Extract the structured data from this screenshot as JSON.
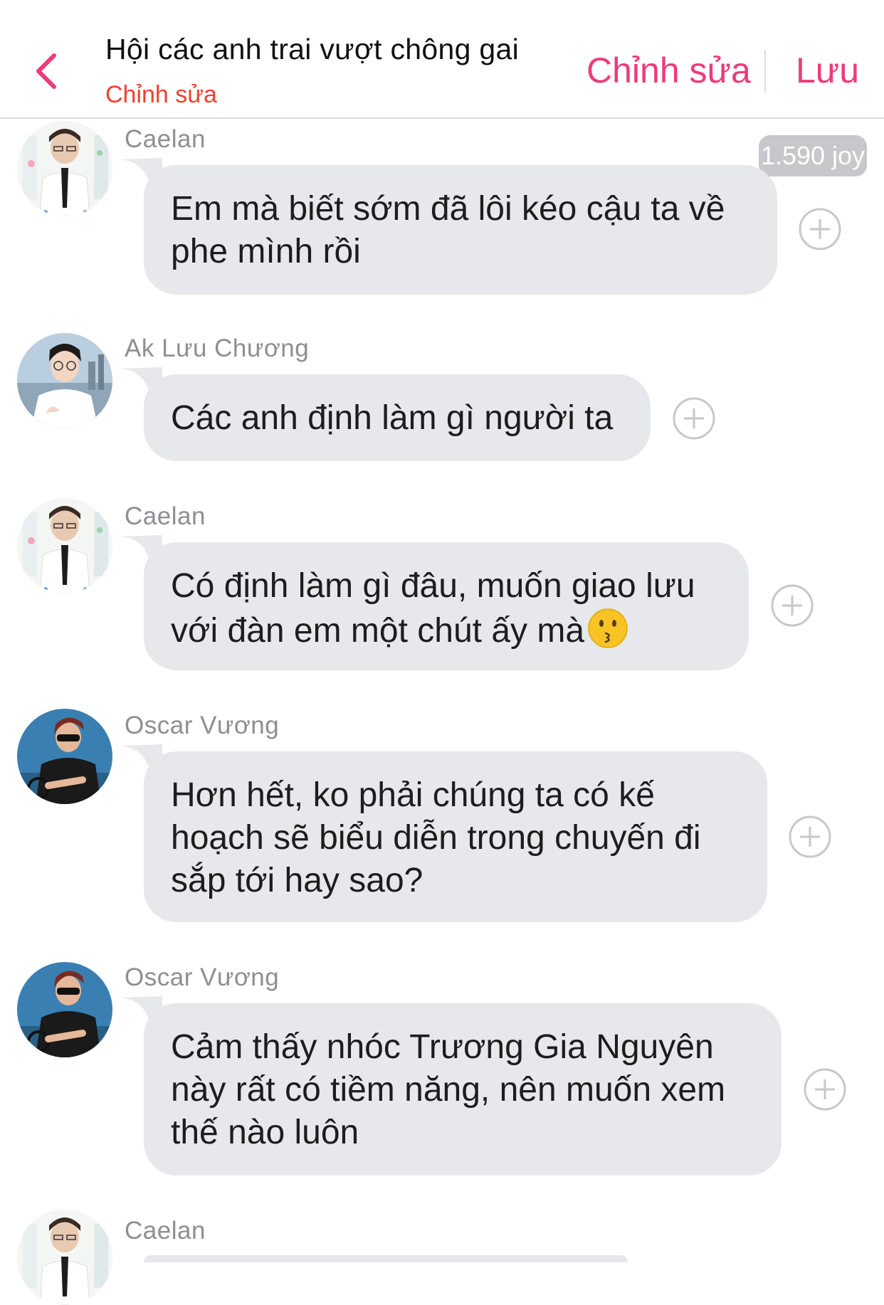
{
  "header": {
    "title": "Hội các anh trai vượt chông gai",
    "subtitle": "Chỉnh sửa",
    "edit_label": "Chỉnh sửa",
    "save_label": "Lưu",
    "accent_color": "#ee3b7a",
    "subtitle_color": "#f04030"
  },
  "messages": [
    {
      "sender": "Caelan",
      "avatar": "caelan-avatar",
      "lines": [
        "Em mà biết sớm đã lôi kéo cậu ta về",
        "phe mình rồi"
      ],
      "joy": "1.590 joy"
    },
    {
      "sender": "Ak Lưu Chương",
      "avatar": "ak-avatar",
      "lines": [
        "Các anh định làm gì người ta"
      ]
    },
    {
      "sender": "Caelan",
      "avatar": "caelan-avatar",
      "lines": [
        "Có định làm gì đâu, muốn giao lưu",
        "với đàn em một chút ấy mà"
      ],
      "emoji": "kissing-face-emoji"
    },
    {
      "sender": "Oscar Vương",
      "avatar": "oscar-avatar",
      "lines": [
        "Hơn hết, ko phải chúng ta có kế",
        "hoạch sẽ biểu diễn trong chuyến đi",
        "sắp tới hay sao?"
      ]
    },
    {
      "sender": "Oscar Vương",
      "avatar": "oscar-avatar",
      "lines": [
        "Cảm thấy nhóc Trương Gia Nguyên",
        "này rất có tiềm năng, nên muốn xem",
        "thế nào luôn"
      ]
    },
    {
      "sender": "Caelan",
      "avatar": "caelan-avatar",
      "lines": []
    }
  ],
  "icons": {
    "back": "chevron-left-icon",
    "add": "plus-circle-icon"
  },
  "bubble_color": "#e6e8eb"
}
